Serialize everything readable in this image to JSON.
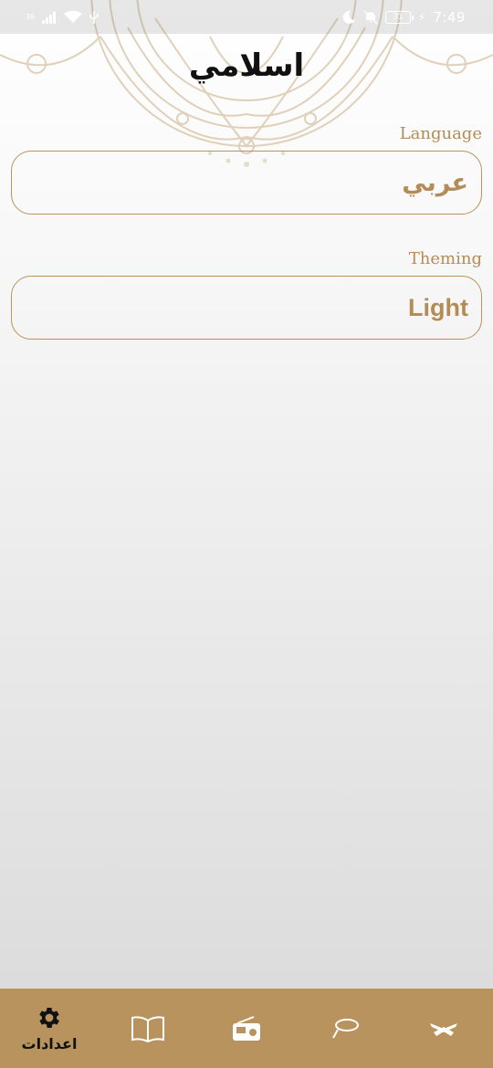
{
  "status_bar": {
    "network": "36",
    "battery": "31",
    "time": "7:49"
  },
  "header": {
    "title": "اسلامي"
  },
  "settings": {
    "language": {
      "label": "Language",
      "value": "عربي"
    },
    "theming": {
      "label": "Theming",
      "value": "Light"
    }
  },
  "bottom_nav": {
    "items": [
      {
        "icon": "gear-icon",
        "label": "اعدادات",
        "active": true
      },
      {
        "icon": "book-icon",
        "label": "",
        "active": false
      },
      {
        "icon": "radio-icon",
        "label": "",
        "active": false
      },
      {
        "icon": "tasbeeh-icon",
        "label": "",
        "active": false
      },
      {
        "icon": "quran-icon",
        "label": "",
        "active": false
      }
    ]
  },
  "colors": {
    "accent": "#b8935e",
    "accent_text": "#b48c55",
    "title": "#111111"
  }
}
